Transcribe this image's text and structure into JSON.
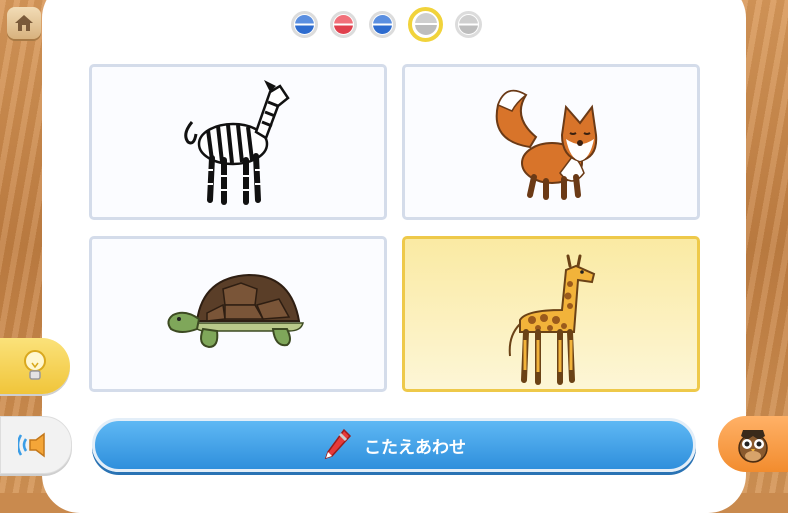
{
  "progress": {
    "dots": [
      {
        "state": "done",
        "color": "blue"
      },
      {
        "state": "done",
        "color": "red"
      },
      {
        "state": "done",
        "color": "blue"
      },
      {
        "state": "current",
        "color": "grey"
      },
      {
        "state": "todo",
        "color": "grey"
      }
    ]
  },
  "choices": [
    {
      "animal": "zebra",
      "selected": false
    },
    {
      "animal": "fox",
      "selected": false
    },
    {
      "animal": "tortoise",
      "selected": false
    },
    {
      "animal": "giraffe",
      "selected": true
    }
  ],
  "answer_button": {
    "label": "こたえあわせ",
    "icon": "pen-icon"
  },
  "buttons": {
    "home": "home-icon",
    "hint": "lightbulb-icon",
    "sound": "speaker-icon",
    "owl": "owl-icon"
  },
  "colors": {
    "answer_button": "#3b9de6",
    "selected_card": "#f8e8a0",
    "hint_button": "#f5d34f",
    "owl_button": "#f59a3d",
    "current_dot_ring": "#f1d33b"
  }
}
